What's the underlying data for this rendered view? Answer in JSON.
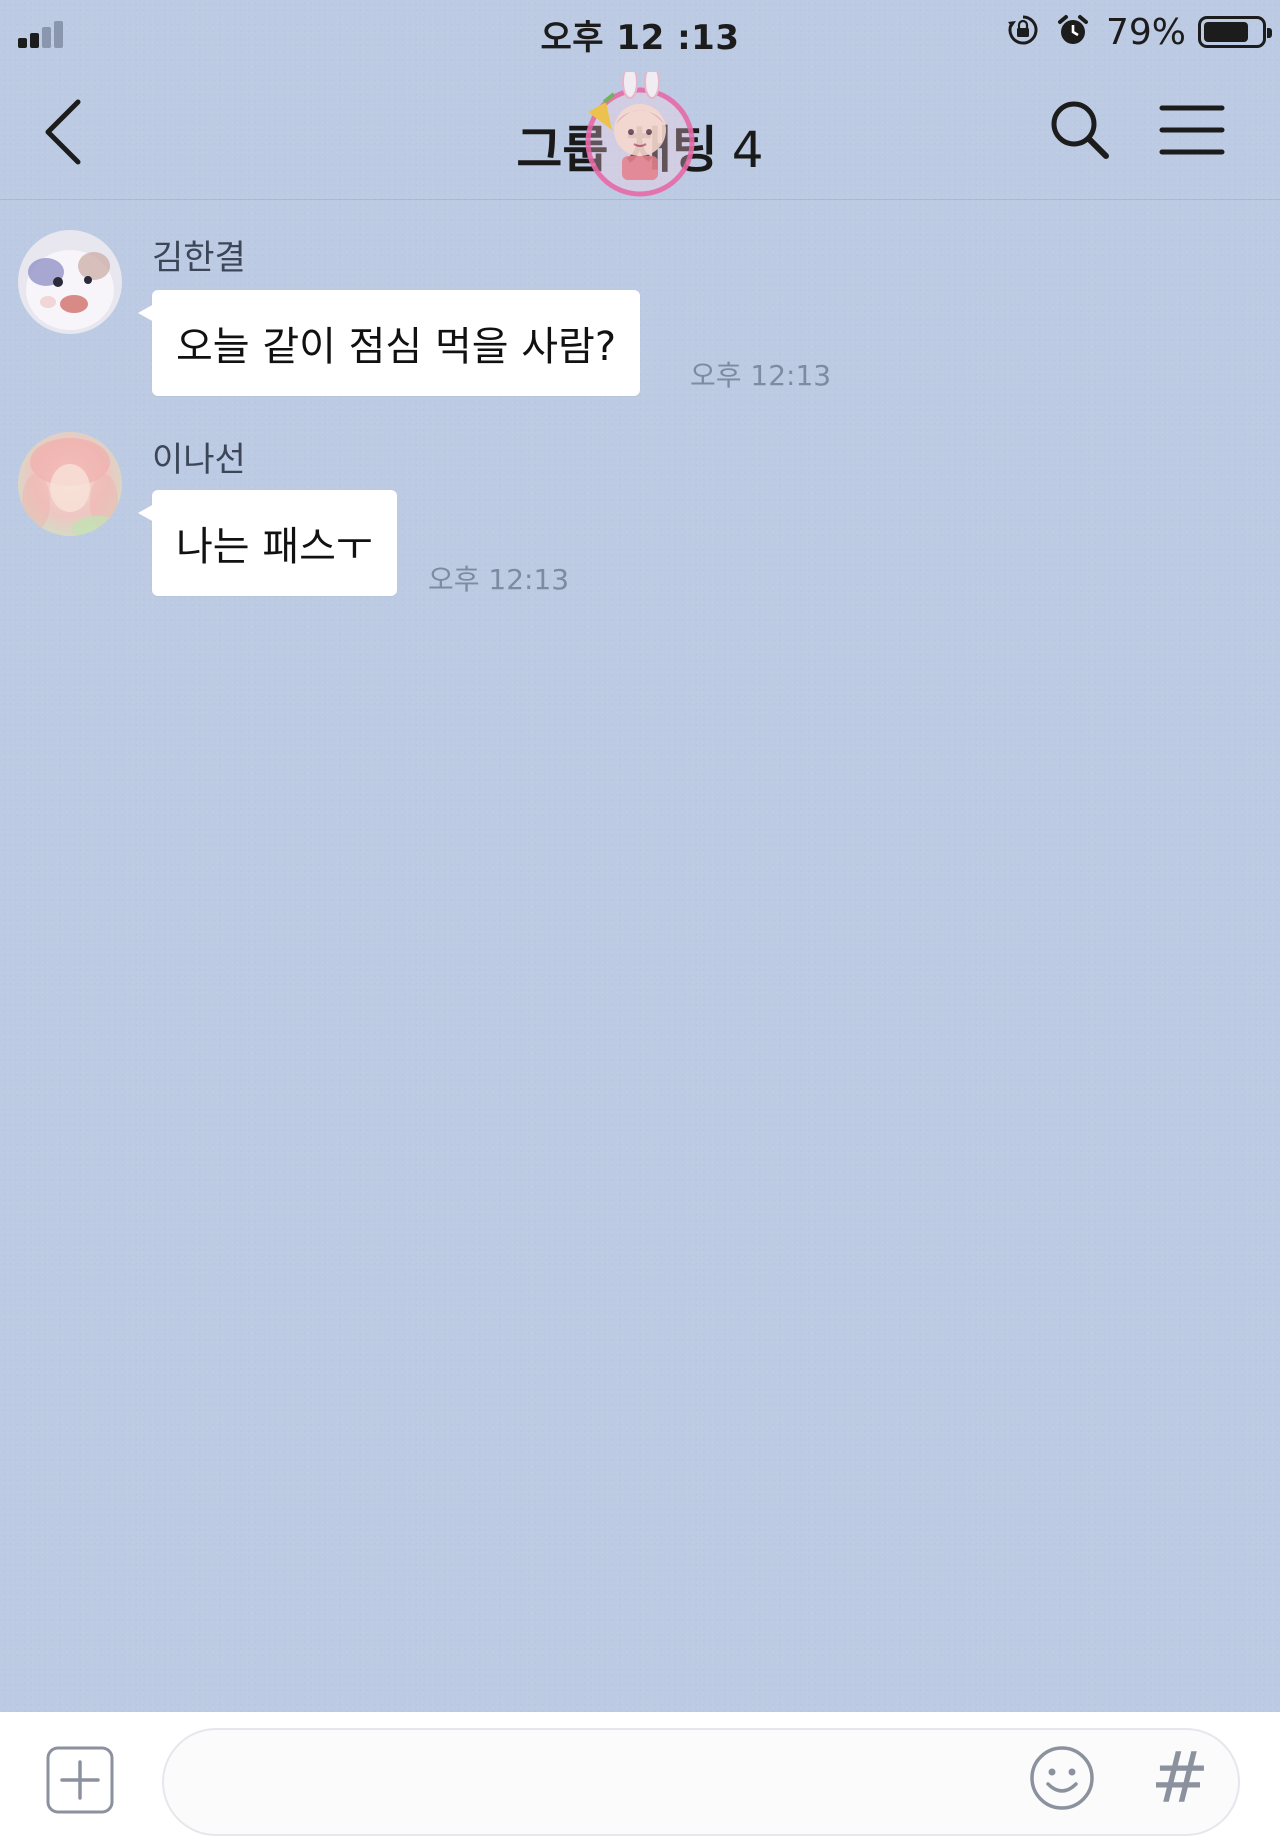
{
  "status_bar": {
    "time": "오후 12 :13",
    "battery_percent": "79%",
    "battery_level": 0.79,
    "icons": [
      "signal-icon",
      "rotation-lock-icon",
      "alarm-icon",
      "battery-icon"
    ]
  },
  "header": {
    "title": "그룹 채팅",
    "member_count": "4",
    "icons": [
      "back-arrow-icon",
      "search-icon",
      "menu-icon"
    ]
  },
  "messages": [
    {
      "sender": "김한결",
      "text": "오늘 같이 점심 먹을 사람?",
      "time": "오후 12:13"
    },
    {
      "sender": "이나선",
      "text": "나는 패스ㅜ",
      "time": "오후 12:13"
    }
  ],
  "input_bar": {
    "value": "",
    "hashtag_label": "#",
    "icons": [
      "add-icon",
      "emoji-icon",
      "hashtag-icon"
    ]
  },
  "colors": {
    "chat_background": "#bccbe3",
    "bubble": "#ffffff",
    "timestamp": "#7d8aa0",
    "input_bar": "#ffffff"
  }
}
